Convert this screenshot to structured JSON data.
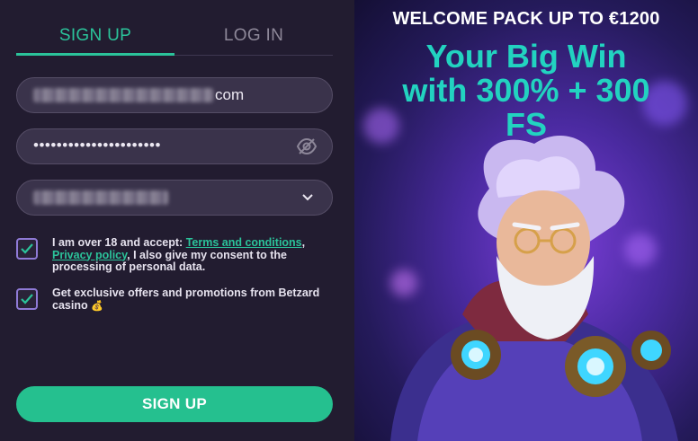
{
  "tabs": {
    "signup_label": "SIGN UP",
    "login_label": "LOG IN"
  },
  "form": {
    "email_visible_suffix": "com",
    "password_mask": "••••••••••••••••••••••",
    "password_toggle_icon": "eye-slash-icon",
    "select_icon": "chevron-down-icon"
  },
  "consent": {
    "age_prefix": "I am over 18 and accept: ",
    "terms_link": "Terms and conditions",
    "comma": ",",
    "privacy_link": "Privacy policy",
    "age_suffix": ", I also give my consent to the processing of personal data.",
    "offers_text": "Get exclusive offers and promotions from Betzard casino",
    "offers_emoji": "💰"
  },
  "cta": {
    "label": "SIGN UP"
  },
  "promo": {
    "pre_title": "WELCOME PACK UP TO €1200",
    "headline_line1": "Your Big Win",
    "headline_line2": "with 300% + 300",
    "headline_line3": "FS"
  },
  "colors": {
    "accent": "#25c08f",
    "panel_bg": "#221c30",
    "promo_text": "#22d3c0"
  }
}
